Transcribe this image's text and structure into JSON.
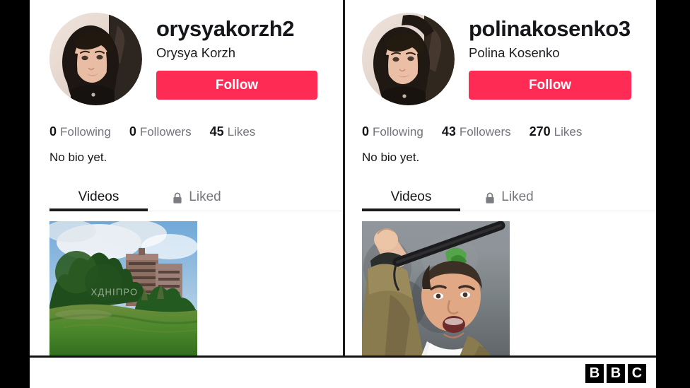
{
  "page": {
    "context": "BBC news screenshot of two TikTok profile pages shown side by side"
  },
  "profiles": [
    {
      "username": "orysyakorzh2",
      "fullname": "Orysya Korzh",
      "follow_label": "Follow",
      "stats": [
        {
          "value": "0",
          "label": "Following"
        },
        {
          "value": "0",
          "label": "Followers"
        },
        {
          "value": "45",
          "label": "Likes"
        }
      ],
      "bio": "No bio yet.",
      "tabs": [
        {
          "label": "Videos",
          "icon": "",
          "active": true
        },
        {
          "label": "Liked",
          "icon": "lock-icon",
          "active": false
        }
      ],
      "video": {
        "description": "Outdoor park scene with grass field, trees and a tall apartment block under a cloudy blue sky",
        "watermark": "ХДНІПРО"
      }
    },
    {
      "username": "polinakosenko3",
      "fullname": "Polina Kosenko",
      "follow_label": "Follow",
      "stats": [
        {
          "value": "0",
          "label": "Following"
        },
        {
          "value": "43",
          "label": "Followers"
        },
        {
          "value": "270",
          "label": "Likes"
        }
      ],
      "bio": "No bio yet.",
      "tabs": [
        {
          "label": "Videos",
          "icon": "",
          "active": true
        },
        {
          "label": "Liked",
          "icon": "lock-icon",
          "active": false
        }
      ],
      "video": {
        "description": "Man in khaki jacket at a protest shouting with arm raised holding a microphone",
        "watermark": ""
      }
    }
  ],
  "footer": {
    "logo_letters": [
      "B",
      "B",
      "C"
    ]
  },
  "colors": {
    "follow_button": "#fe2c55",
    "text_primary": "#15161a",
    "text_secondary": "#73747b",
    "letterbox": "#000000",
    "tab_underline": "#191b1f"
  }
}
